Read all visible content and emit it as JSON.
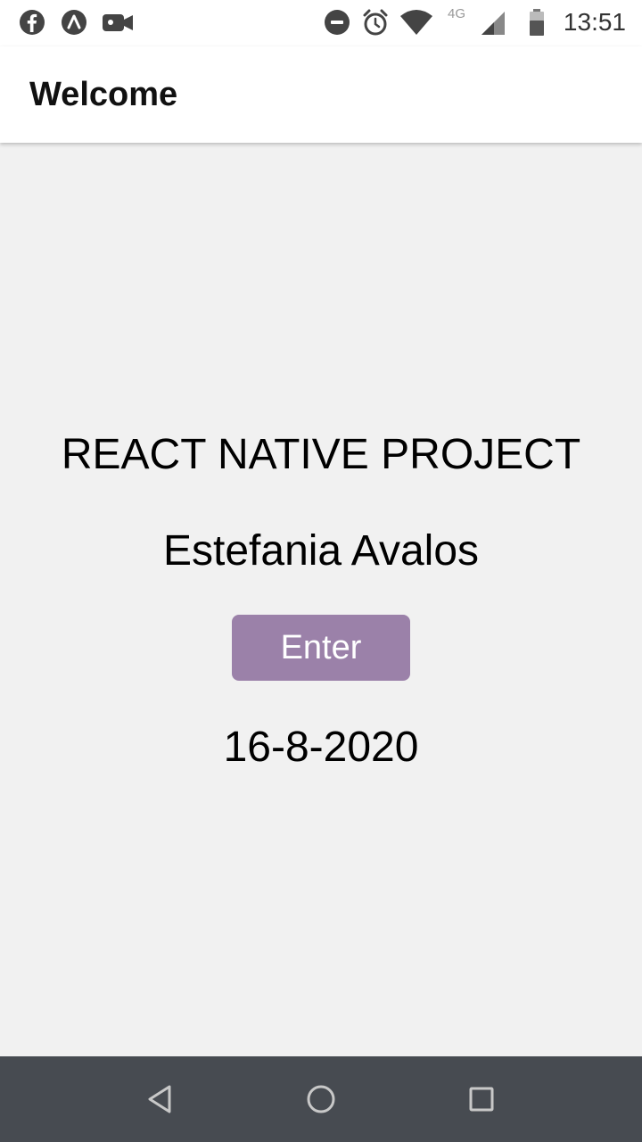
{
  "status_bar": {
    "time": "13:51",
    "network_label": "4G",
    "left_icons": [
      "facebook-icon",
      "app-notification-icon",
      "video-icon"
    ],
    "right_icons": [
      "do-not-disturb-icon",
      "alarm-icon",
      "wifi-icon",
      "cell-signal-icon",
      "battery-icon"
    ]
  },
  "app_bar": {
    "title": "Welcome"
  },
  "main": {
    "project_title": "REACT NATIVE PROJECT",
    "author": "Estefania Avalos",
    "enter_button_label": "Enter",
    "date": "16-8-2020"
  },
  "nav_bar": {
    "buttons": [
      "back-icon",
      "home-icon",
      "recents-icon"
    ]
  },
  "colors": {
    "button_bg": "#9b81a9",
    "button_text": "#ffffff",
    "background": "#f1f1f1",
    "nav_bar_bg": "#474b51"
  }
}
